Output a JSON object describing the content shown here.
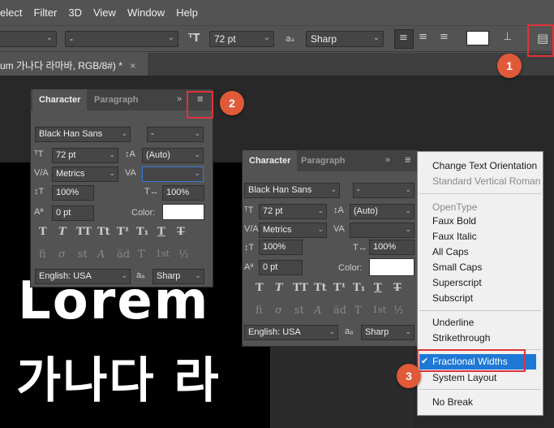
{
  "menubar": {
    "items": [
      "elect",
      "Filter",
      "3D",
      "View",
      "Window",
      "Help"
    ]
  },
  "options": {
    "font_family": "",
    "font_style": "-",
    "size": "72 pt",
    "aa_label": "aₐ",
    "aa": "Sharp"
  },
  "doc_tab": {
    "title": "um 가나다 라마바, RGB/8#) *",
    "close": "×"
  },
  "canvas_text": {
    "line1": "Lorem",
    "line2": "가나다 라"
  },
  "panel": {
    "tabs": [
      "Character",
      "Paragraph"
    ],
    "font": "Black Han Sans",
    "style": "-",
    "size": "72 pt",
    "leading": "(Auto)",
    "kerning": "Metrics",
    "tracking": "",
    "vscale": "100%",
    "hscale": "100%",
    "baseline": "0 pt",
    "color_label": "Color:",
    "language": "English: USA",
    "aa_label": "aₐ",
    "aa": "Sharp",
    "styles": [
      "T",
      "T",
      "TT",
      "Tt",
      "T¹",
      "T₁",
      "T",
      "T"
    ],
    "opentype": [
      "fi",
      "σ",
      "st",
      "A",
      "a̅d",
      "T",
      "1st",
      "½"
    ],
    "collapse": "»"
  },
  "menu": {
    "items": [
      {
        "label": "Change Text Orientation",
        "disabled": false
      },
      {
        "label": "Standard Vertical Roman",
        "disabled": true
      },
      {
        "label": "OpenType",
        "disabled": true
      },
      {
        "label": "Faux Bold",
        "disabled": false
      },
      {
        "label": "Faux Italic",
        "disabled": false
      },
      {
        "label": "All Caps",
        "disabled": false
      },
      {
        "label": "Small Caps",
        "disabled": false
      },
      {
        "label": "Superscript",
        "disabled": false
      },
      {
        "label": "Subscript",
        "disabled": false
      },
      {
        "label": "Underline",
        "disabled": false
      },
      {
        "label": "Strikethrough",
        "disabled": false
      },
      {
        "label": "Fractional Widths",
        "disabled": false,
        "checked": true
      },
      {
        "label": "System Layout",
        "disabled": false
      },
      {
        "label": "No Break",
        "disabled": false
      }
    ],
    "check": "✔"
  },
  "badges": [
    "1",
    "2",
    "3"
  ],
  "colors": {
    "accent": "#1e78d6",
    "badge": "#e05a3a",
    "callout": "#e0333a"
  }
}
